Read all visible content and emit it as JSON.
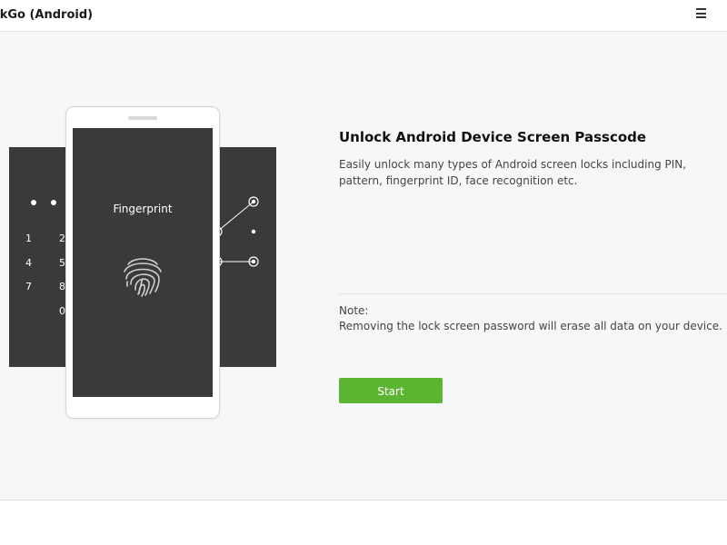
{
  "window": {
    "title": "ckGo (Android)",
    "menu_icon": "hamburger-menu-icon"
  },
  "illustration": {
    "phone_screen_label": "Fingerprint",
    "pin_digits": [
      "1",
      "2",
      "4",
      "5",
      "7",
      "8",
      "0"
    ],
    "fingerprint_icon": "fingerprint-icon",
    "pattern_icon": "pattern-lock-icon"
  },
  "content": {
    "title": "Unlock Android Device Screen Passcode",
    "description": "Easily unlock many types of Android screen locks including PIN, pattern, fingerprint ID, face recognition etc.",
    "note_label": "Note:",
    "note_text": "Removing the lock screen password will erase all data on your device.",
    "start_label": "Start"
  },
  "colors": {
    "accent": "#5cb531",
    "panel": "#3a3a3a",
    "background": "#f6f7f9"
  }
}
